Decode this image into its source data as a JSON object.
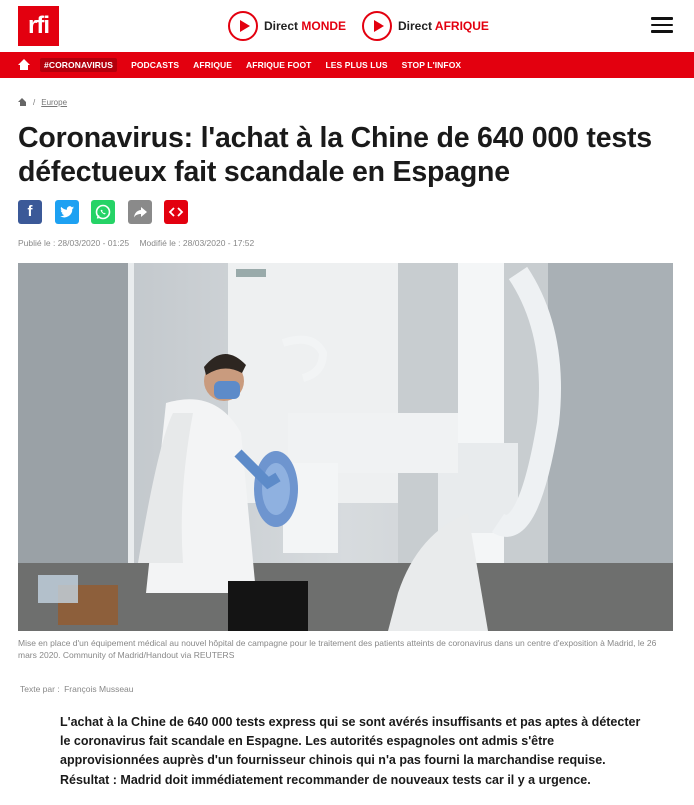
{
  "header": {
    "logo_text": "rfi",
    "direct_monde_prefix": "Direct",
    "direct_monde_name": "MONDE",
    "direct_afrique_prefix": "Direct",
    "direct_afrique_name": "AFRIQUE",
    "menu_icon": "hamburger-icon"
  },
  "nav": {
    "home_icon": "home-icon",
    "items": [
      "#CORONAVIRUS",
      "PODCASTS",
      "AFRIQUE",
      "AFRIQUE FOOT",
      "LES PLUS LUS",
      "STOP L'INFOX"
    ]
  },
  "breadcrumb": {
    "home_icon": "home-icon",
    "separator": "/",
    "section": "Europe"
  },
  "article": {
    "title": "Coronavirus: l'achat à la Chine de 640 000 tests défectueux fait scandale en Espagne",
    "share_icons": [
      "facebook-icon",
      "twitter-icon",
      "whatsapp-icon",
      "share-icon",
      "embed-icon"
    ],
    "published": "Publié le : 28/03/2020 - 01:25",
    "modified": "Modifié le : 28/03/2020 - 17:52",
    "image_caption": "Mise en place d'un équipement médical au nouvel hôpital de campagne pour le traitement des patients atteints de coronavirus dans un centre d'exposition à Madrid, le 26 mars 2020.  Community of Madrid/Handout via REUTERS",
    "author_label": "Texte par :",
    "author_name": "François Musseau",
    "chapo": "L'achat à la Chine de 640 000 tests express qui se sont avérés insuffisants et pas aptes à détecter le coronavirus fait scandale en Espagne. Les autorités espagnoles ont admis s'être approvisionnées auprès d'un fournisseur chinois qui n'a pas fourni la marchandise requise. Résultat : Madrid doit immédiatement recommander de nouveaux tests car il y a urgence."
  },
  "colors": {
    "brand_red": "#e3000f",
    "facebook": "#3b5998",
    "twitter": "#1da1f2",
    "whatsapp": "#25d366",
    "share": "#8a8a8a"
  }
}
